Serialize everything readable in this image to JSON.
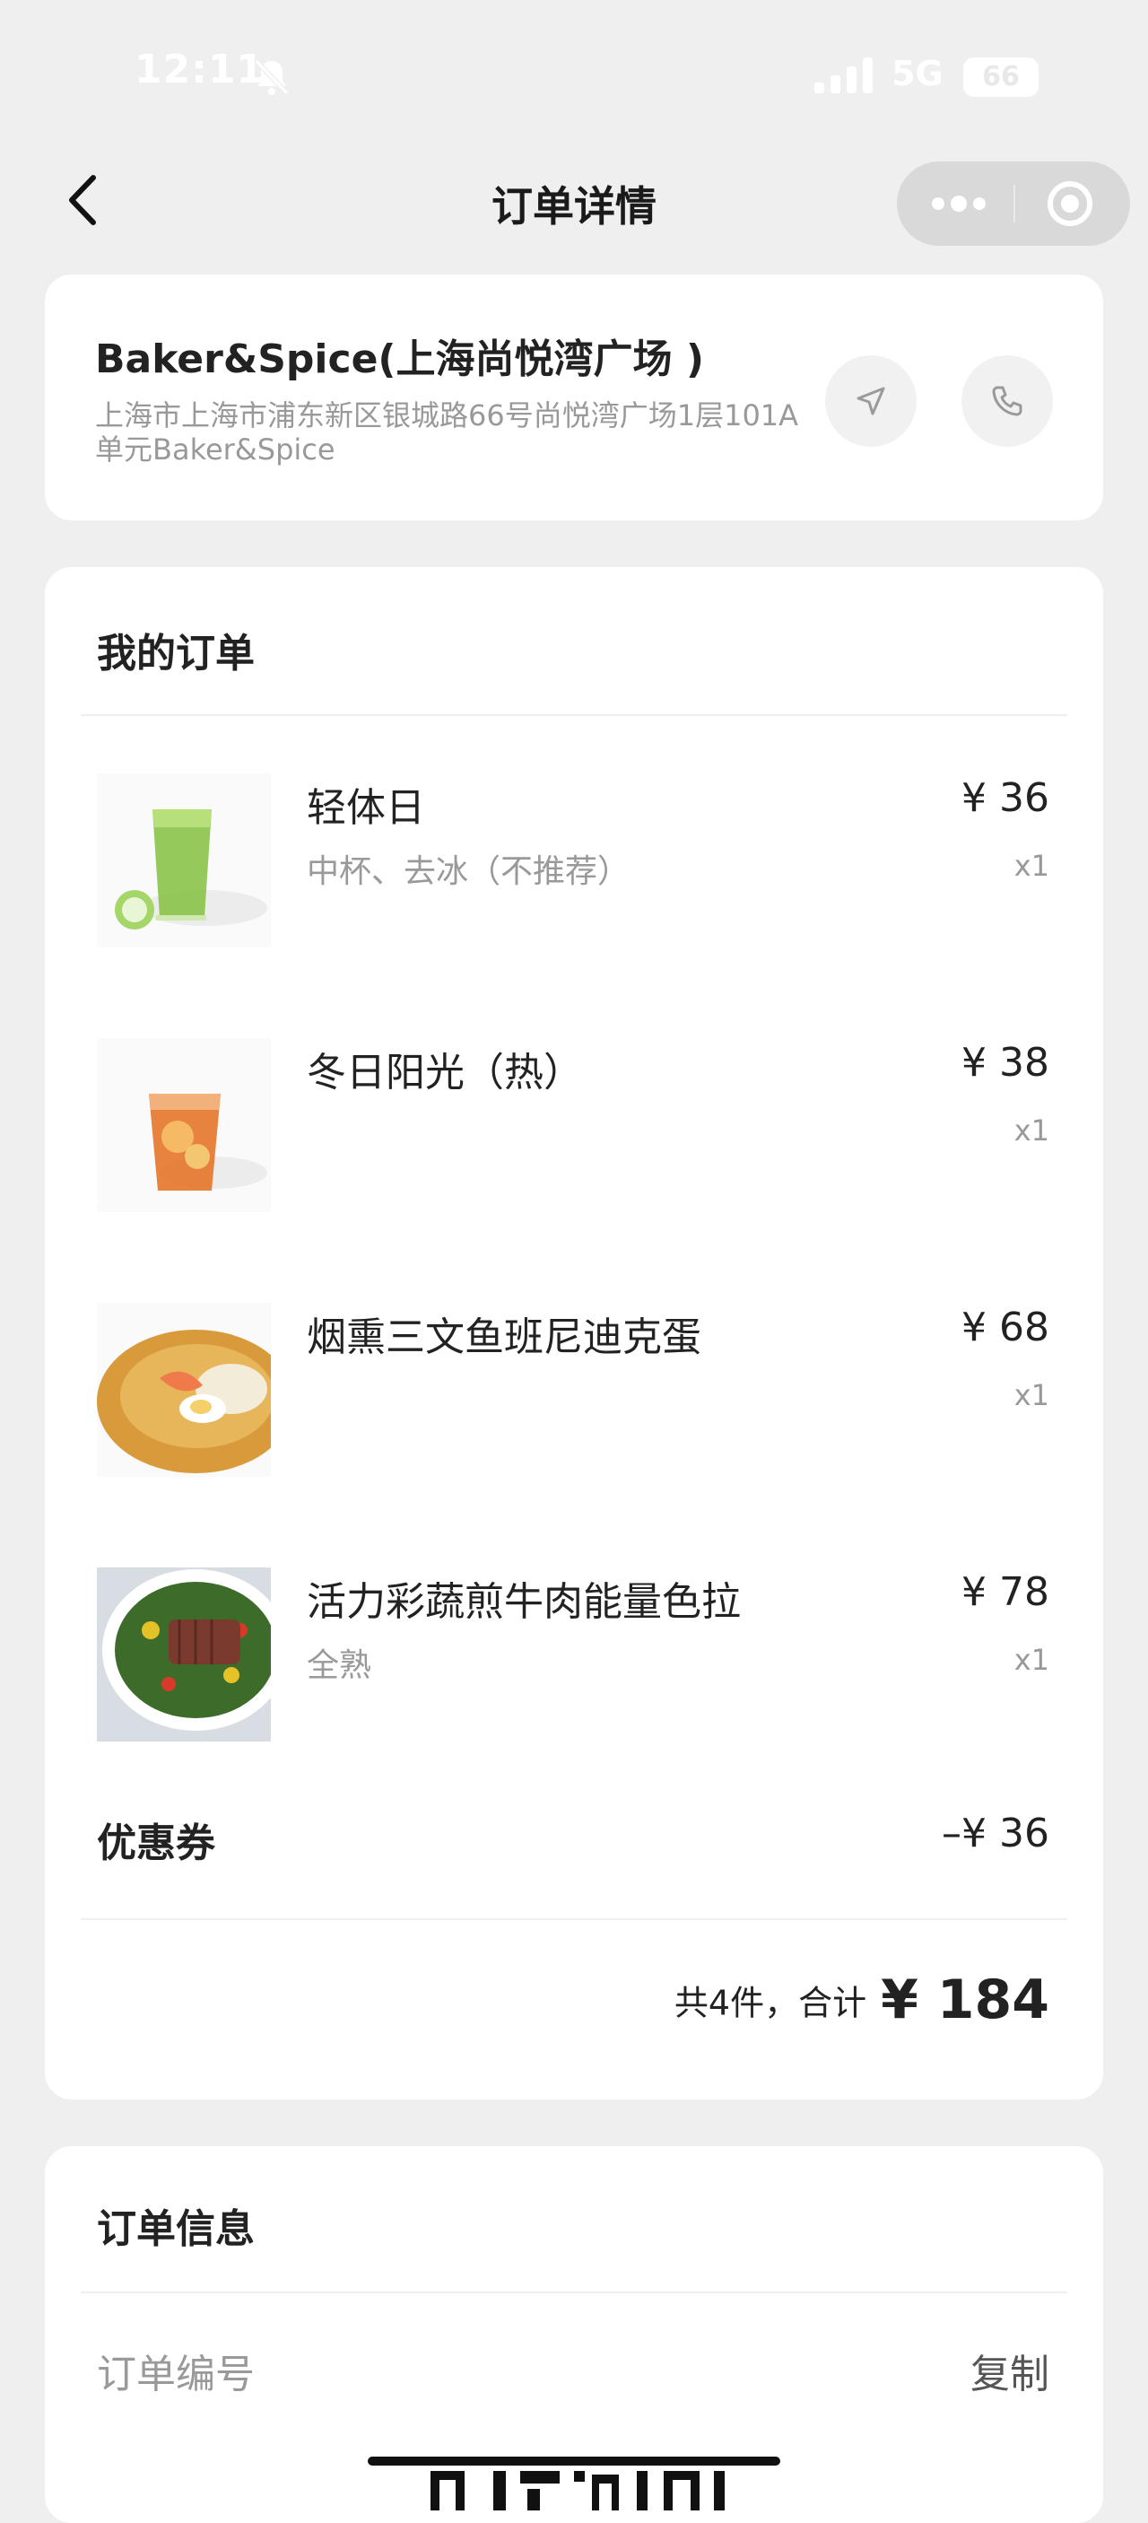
{
  "status_bar": {
    "time": "12:11",
    "network": "5G",
    "battery": "66"
  },
  "nav": {
    "title": "订单详情"
  },
  "store": {
    "name": "Baker&Spice(上海尚悦湾广场 )",
    "address": "上海市上海市浦东新区银城路66号尚悦湾广场1层101A单元Baker&Spice"
  },
  "order": {
    "title": "我的订单",
    "items": [
      {
        "name": "轻体日",
        "spec": "中杯、去冰（不推荐）",
        "price": "¥ 36",
        "qty": "x1"
      },
      {
        "name": "冬日阳光（热）",
        "spec": "",
        "price": "¥ 38",
        "qty": "x1"
      },
      {
        "name": "烟熏三文鱼班尼迪克蛋",
        "spec": "",
        "price": "¥ 68",
        "qty": "x1"
      },
      {
        "name": "活力彩蔬煎牛肉能量色拉",
        "spec": "全熟",
        "price": "¥ 78",
        "qty": "x1"
      }
    ],
    "coupon_label": "优惠券",
    "coupon_value": "–¥ 36",
    "total_label": "共4件，合计",
    "total_value": "¥ 184"
  },
  "info": {
    "title": "订单信息",
    "order_no_label": "订单编号",
    "copy_label": "复制"
  },
  "colors": {
    "background": "#efefef",
    "card": "#ffffff",
    "muted_text": "#999999"
  }
}
